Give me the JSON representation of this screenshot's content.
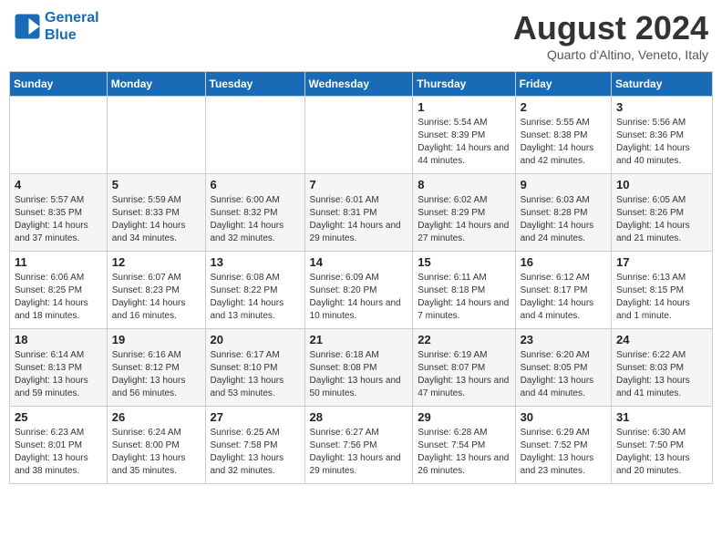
{
  "header": {
    "logo_line1": "General",
    "logo_line2": "Blue",
    "month": "August 2024",
    "location": "Quarto d'Altino, Veneto, Italy"
  },
  "days_of_week": [
    "Sunday",
    "Monday",
    "Tuesday",
    "Wednesday",
    "Thursday",
    "Friday",
    "Saturday"
  ],
  "weeks": [
    [
      {
        "day": "",
        "info": ""
      },
      {
        "day": "",
        "info": ""
      },
      {
        "day": "",
        "info": ""
      },
      {
        "day": "",
        "info": ""
      },
      {
        "day": "1",
        "info": "Sunrise: 5:54 AM\nSunset: 8:39 PM\nDaylight: 14 hours and 44 minutes."
      },
      {
        "day": "2",
        "info": "Sunrise: 5:55 AM\nSunset: 8:38 PM\nDaylight: 14 hours and 42 minutes."
      },
      {
        "day": "3",
        "info": "Sunrise: 5:56 AM\nSunset: 8:36 PM\nDaylight: 14 hours and 40 minutes."
      }
    ],
    [
      {
        "day": "4",
        "info": "Sunrise: 5:57 AM\nSunset: 8:35 PM\nDaylight: 14 hours and 37 minutes."
      },
      {
        "day": "5",
        "info": "Sunrise: 5:59 AM\nSunset: 8:33 PM\nDaylight: 14 hours and 34 minutes."
      },
      {
        "day": "6",
        "info": "Sunrise: 6:00 AM\nSunset: 8:32 PM\nDaylight: 14 hours and 32 minutes."
      },
      {
        "day": "7",
        "info": "Sunrise: 6:01 AM\nSunset: 8:31 PM\nDaylight: 14 hours and 29 minutes."
      },
      {
        "day": "8",
        "info": "Sunrise: 6:02 AM\nSunset: 8:29 PM\nDaylight: 14 hours and 27 minutes."
      },
      {
        "day": "9",
        "info": "Sunrise: 6:03 AM\nSunset: 8:28 PM\nDaylight: 14 hours and 24 minutes."
      },
      {
        "day": "10",
        "info": "Sunrise: 6:05 AM\nSunset: 8:26 PM\nDaylight: 14 hours and 21 minutes."
      }
    ],
    [
      {
        "day": "11",
        "info": "Sunrise: 6:06 AM\nSunset: 8:25 PM\nDaylight: 14 hours and 18 minutes."
      },
      {
        "day": "12",
        "info": "Sunrise: 6:07 AM\nSunset: 8:23 PM\nDaylight: 14 hours and 16 minutes."
      },
      {
        "day": "13",
        "info": "Sunrise: 6:08 AM\nSunset: 8:22 PM\nDaylight: 14 hours and 13 minutes."
      },
      {
        "day": "14",
        "info": "Sunrise: 6:09 AM\nSunset: 8:20 PM\nDaylight: 14 hours and 10 minutes."
      },
      {
        "day": "15",
        "info": "Sunrise: 6:11 AM\nSunset: 8:18 PM\nDaylight: 14 hours and 7 minutes."
      },
      {
        "day": "16",
        "info": "Sunrise: 6:12 AM\nSunset: 8:17 PM\nDaylight: 14 hours and 4 minutes."
      },
      {
        "day": "17",
        "info": "Sunrise: 6:13 AM\nSunset: 8:15 PM\nDaylight: 14 hours and 1 minute."
      }
    ],
    [
      {
        "day": "18",
        "info": "Sunrise: 6:14 AM\nSunset: 8:13 PM\nDaylight: 13 hours and 59 minutes."
      },
      {
        "day": "19",
        "info": "Sunrise: 6:16 AM\nSunset: 8:12 PM\nDaylight: 13 hours and 56 minutes."
      },
      {
        "day": "20",
        "info": "Sunrise: 6:17 AM\nSunset: 8:10 PM\nDaylight: 13 hours and 53 minutes."
      },
      {
        "day": "21",
        "info": "Sunrise: 6:18 AM\nSunset: 8:08 PM\nDaylight: 13 hours and 50 minutes."
      },
      {
        "day": "22",
        "info": "Sunrise: 6:19 AM\nSunset: 8:07 PM\nDaylight: 13 hours and 47 minutes."
      },
      {
        "day": "23",
        "info": "Sunrise: 6:20 AM\nSunset: 8:05 PM\nDaylight: 13 hours and 44 minutes."
      },
      {
        "day": "24",
        "info": "Sunrise: 6:22 AM\nSunset: 8:03 PM\nDaylight: 13 hours and 41 minutes."
      }
    ],
    [
      {
        "day": "25",
        "info": "Sunrise: 6:23 AM\nSunset: 8:01 PM\nDaylight: 13 hours and 38 minutes."
      },
      {
        "day": "26",
        "info": "Sunrise: 6:24 AM\nSunset: 8:00 PM\nDaylight: 13 hours and 35 minutes."
      },
      {
        "day": "27",
        "info": "Sunrise: 6:25 AM\nSunset: 7:58 PM\nDaylight: 13 hours and 32 minutes."
      },
      {
        "day": "28",
        "info": "Sunrise: 6:27 AM\nSunset: 7:56 PM\nDaylight: 13 hours and 29 minutes."
      },
      {
        "day": "29",
        "info": "Sunrise: 6:28 AM\nSunset: 7:54 PM\nDaylight: 13 hours and 26 minutes."
      },
      {
        "day": "30",
        "info": "Sunrise: 6:29 AM\nSunset: 7:52 PM\nDaylight: 13 hours and 23 minutes."
      },
      {
        "day": "31",
        "info": "Sunrise: 6:30 AM\nSunset: 7:50 PM\nDaylight: 13 hours and 20 minutes."
      }
    ]
  ]
}
